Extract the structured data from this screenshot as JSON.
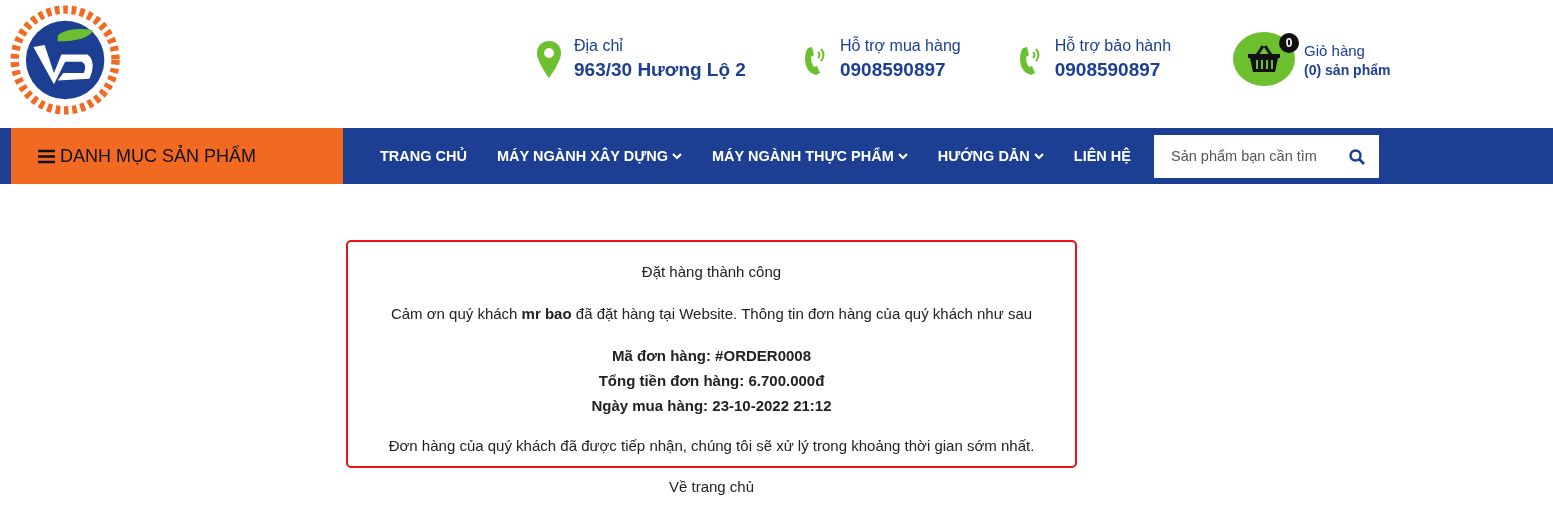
{
  "header": {
    "contacts": [
      {
        "kind": "location",
        "label": "Địa chỉ",
        "value": "963/30 Hương Lộ 2"
      },
      {
        "kind": "phone",
        "label": "Hỗ trợ mua hàng",
        "value": "0908590897"
      },
      {
        "kind": "phone",
        "label": "Hỗ trợ bảo hành",
        "value": "0908590897"
      }
    ],
    "cart": {
      "count": "0",
      "label": "Giỏ hàng",
      "summary": "(0) sản phẩm"
    }
  },
  "nav": {
    "menu_label": "DANH MỤC SẢN PHẨM",
    "items": [
      {
        "label": "TRANG CHỦ",
        "dropdown": false
      },
      {
        "label": "MÁY NGÀNH XÂY DỰNG",
        "dropdown": true
      },
      {
        "label": "MÁY NGÀNH THỰC PHẨM",
        "dropdown": true
      },
      {
        "label": "HƯỚNG DẪN",
        "dropdown": true
      },
      {
        "label": "LIÊN HỆ",
        "dropdown": false
      }
    ],
    "search": {
      "placeholder": "Sản phẩm bạn cần tìm"
    }
  },
  "confirmation": {
    "title": "Đặt hàng thành công",
    "thanks": "Cảm ơn quý khách **mr bao** đã đặt hàng tại Website. Thông tin đơn hàng của quý khách như sau",
    "details": [
      "Mã đơn hàng: #ORDER0008",
      "Tổng tiền đơn hàng: 6.700.000đ",
      "Ngày mua hàng: 23-10-2022 21:12"
    ],
    "note": "Đơn hàng của quý khách đã được tiếp nhận, chúng tôi sẽ xử lý trong khoảng thời gian sớm nhất."
  },
  "home_link": "Về trang chủ"
}
